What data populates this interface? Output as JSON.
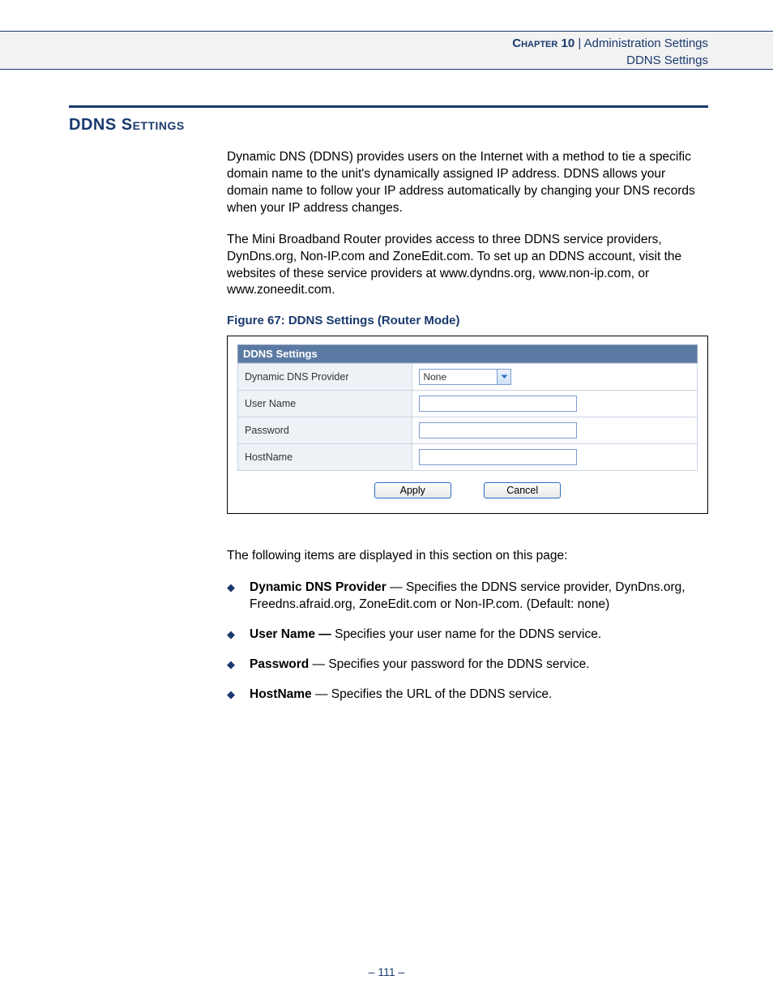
{
  "header": {
    "chapter_prefix": "Chapter 10",
    "separator": " | ",
    "chapter_name": "Administration Settings",
    "sub": "DDNS Settings"
  },
  "section_title": "DDNS Settings",
  "paragraphs": {
    "p1": "Dynamic DNS (DDNS) provides users on the Internet with a method to tie a specific domain name to the unit's dynamically assigned IP address. DDNS allows your domain name to follow your IP address automatically by changing your DNS records when your IP address changes.",
    "p2": "The Mini Broadband Router provides access to three DDNS service providers, DynDns.org, Non-IP.com and ZoneEdit.com. To set up an DDNS account, visit the websites of these service providers at www.dyndns.org, www.non-ip.com, or www.zoneedit.com.",
    "p3": "The following items are displayed in this section on this page:"
  },
  "figure": {
    "caption": "Figure 67:  DDNS Settings (Router Mode)",
    "panel_title": "DDNS Settings",
    "rows": {
      "provider_label": "Dynamic DNS Provider",
      "provider_value": "None",
      "username_label": "User Name",
      "username_value": "",
      "password_label": "Password",
      "password_value": "",
      "hostname_label": "HostName",
      "hostname_value": ""
    },
    "buttons": {
      "apply": "Apply",
      "cancel": "Cancel"
    }
  },
  "bullets": {
    "b1_term": "Dynamic DNS Provider",
    "b1_text": " — Specifies the DDNS service provider, DynDns.org, Freedns.afraid.org, ZoneEdit.com or Non-IP.com. (Default: none)",
    "b2_term": "User Name —",
    "b2_text": " Specifies your user name for the DDNS service.",
    "b3_term": "Password",
    "b3_text": " — Specifies your password for the DDNS service.",
    "b4_term": "HostName",
    "b4_text": " — Specifies the URL of the DDNS service."
  },
  "page_number": "– 111 –"
}
